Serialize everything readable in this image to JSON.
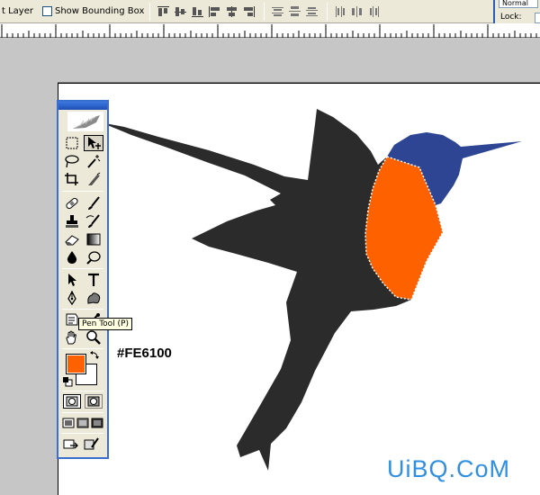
{
  "options_bar": {
    "layer_label": "t Layer",
    "show_bounding_box": "Show Bounding Box",
    "show_bounding_box_checked": false
  },
  "layers_panel": {
    "blend_mode": "Normal",
    "lock_label": "Lock:"
  },
  "toolbox": {
    "tooltip": "Pen Tool (P)",
    "foreground_color": "#FE6100",
    "background_color": "#FFFFFF"
  },
  "annotation": {
    "hex_label": "#FE6100"
  },
  "artwork": {
    "body_color": "#2b2b2b",
    "head_color": "#2e4594",
    "throat_color": "#fe6100"
  },
  "watermark": {
    "text": "UiBQ.CoM",
    "color": "#2f8fe0"
  }
}
